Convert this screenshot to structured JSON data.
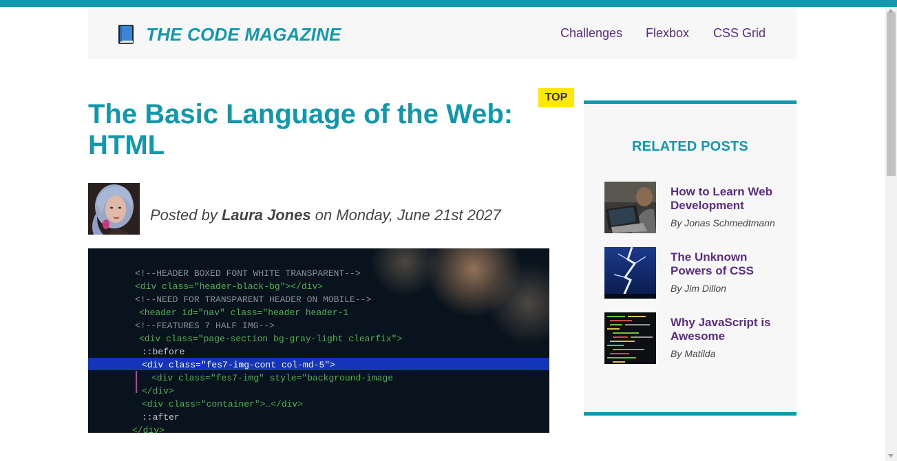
{
  "header": {
    "logo_icon": "book-icon",
    "logo_text": "THE CODE MAGAZINE",
    "nav": [
      {
        "label": "Challenges"
      },
      {
        "label": "Flexbox"
      },
      {
        "label": "CSS Grid"
      }
    ]
  },
  "article": {
    "badge": "TOP",
    "title": "The Basic Language of the Web: HTML",
    "byline": {
      "prefix": "Posted by",
      "author": "Laura Jones",
      "date_text": "on Monday, June 21st 2027"
    },
    "hero_code_lines": [
      "<!--HEADER BOXED FONT WHITE TRANSPARENT-->",
      "<div class=\"header-black-bg\"></div>",
      "<!--NEED FOR TRANSPARENT HEADER ON MOBILE-->",
      "<header id=\"nav\" class=\"header header-1",
      "<!--FEATURES 7 HALF IMG-->",
      "<div class=\"page-section bg-gray-light clearfix\">",
      "::before",
      "<div class=\"fes7-img-cont col-md-5\">",
      "<div class=\"fes7-img\" style=\"background-image",
      "</div>",
      "<div class=\"container\">…</div>",
      "::after",
      "</div>"
    ]
  },
  "related": {
    "title": "RELATED POSTS",
    "posts": [
      {
        "title": "How to Learn Web Development",
        "author": "By Jonas Schmedtmann"
      },
      {
        "title": "The Unknown Powers of CSS",
        "author": "By Jim Dillon"
      },
      {
        "title": "Why JavaScript is Awesome",
        "author": "By Matilda"
      }
    ]
  },
  "colors": {
    "accent": "#1098ad",
    "link": "#5a2c83",
    "badge": "#ffe70a",
    "panel": "#f7f7f7"
  }
}
